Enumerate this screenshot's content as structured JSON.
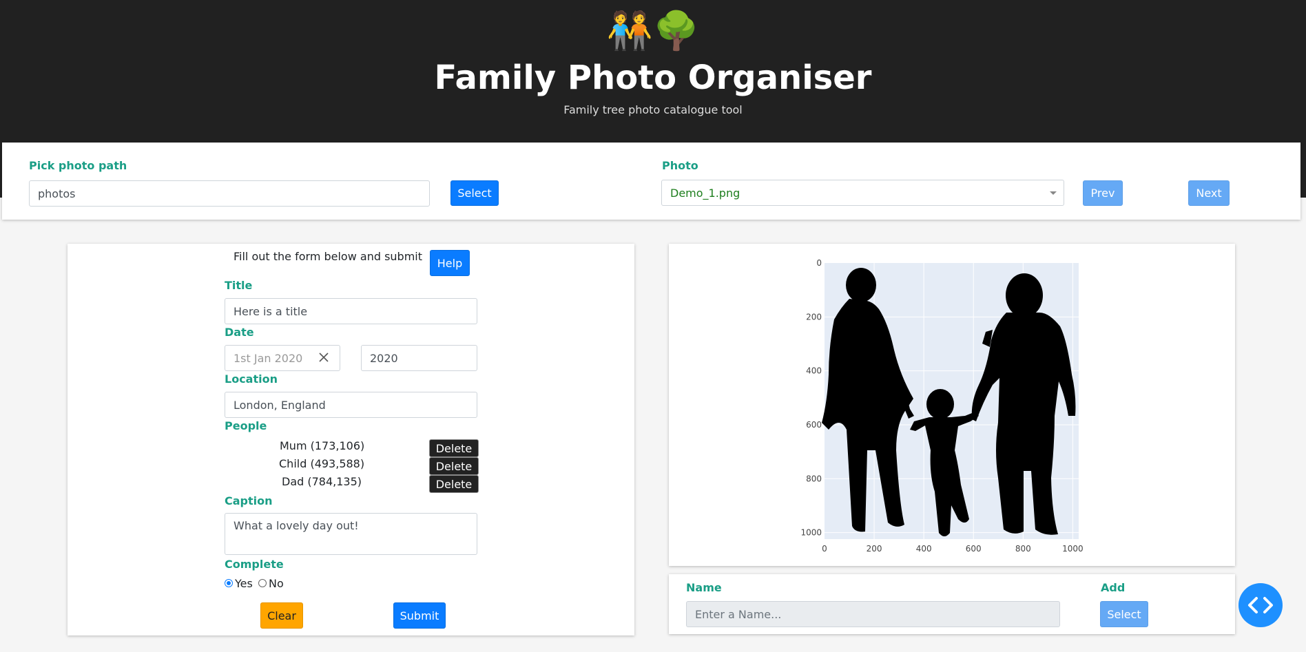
{
  "header": {
    "logo_icons": "🧑‍🤝‍🧑🌳",
    "title": "Family Photo Organiser",
    "subtitle": "Family tree photo catalogue tool"
  },
  "toolbar": {
    "path_label": "Pick photo path",
    "path_value": "photos",
    "select_label": "Select",
    "photo_label": "Photo",
    "photo_value": "Demo_1.png",
    "prev_label": "Prev",
    "next_label": "Next"
  },
  "form": {
    "instruction": "Fill out the form below and submit",
    "help_label": "Help",
    "title_label": "Title",
    "title_value": "Here is a title",
    "date_label": "Date",
    "date_placeholder": "1st Jan 2020",
    "year_value": "2020",
    "location_label": "Location",
    "location_value": "London, England",
    "people_label": "People",
    "people": [
      {
        "name": "Mum (173,106)",
        "delete": "Delete"
      },
      {
        "name": "Child (493,588)",
        "delete": "Delete"
      },
      {
        "name": "Dad (784,135)",
        "delete": "Delete"
      }
    ],
    "caption_label": "Caption",
    "caption_value": "What a lovely day out!",
    "complete_label": "Complete",
    "complete_options": [
      "Yes",
      "No"
    ],
    "complete_selected": "Yes",
    "clear_label": "Clear",
    "submit_label": "Submit"
  },
  "name_panel": {
    "name_label": "Name",
    "name_placeholder": "Enter a Name...",
    "add_label": "Add",
    "select_label": "Select"
  },
  "colors": {
    "header_bg": "#212121",
    "label_teal": "#1a9e86",
    "primary_blue": "#0a7cff",
    "light_blue": "#65a9f5",
    "clear_amber": "#ffa500",
    "plot_bg": "#e5ecf6"
  },
  "chart_data": {
    "type": "image",
    "x_ticks": [
      0,
      200,
      400,
      600,
      800,
      1000
    ],
    "y_ticks": [
      0,
      200,
      400,
      600,
      800,
      1000
    ],
    "xlim": [
      0,
      1024
    ],
    "ylim": [
      1024,
      0
    ],
    "grid": true
  }
}
